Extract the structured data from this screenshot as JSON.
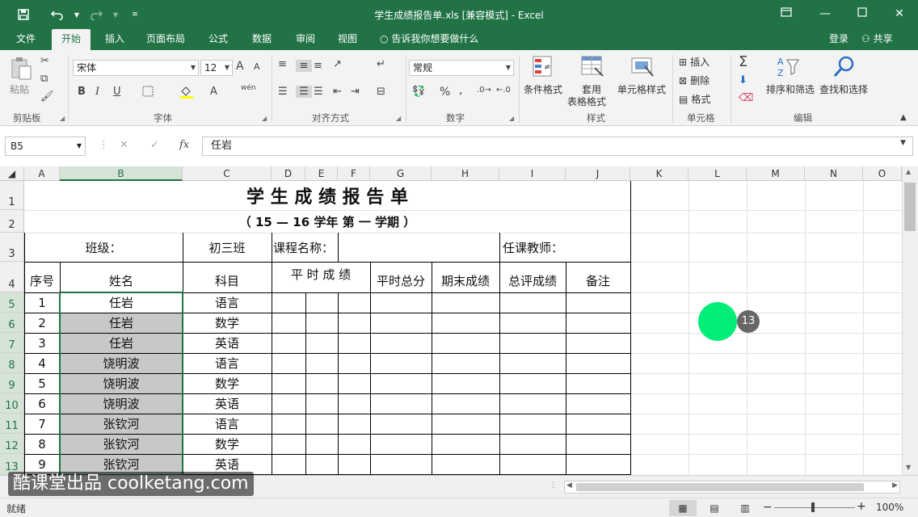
{
  "window": {
    "title": "学生成绩报告单.xls  [兼容模式] - Excel",
    "qat_icons": [
      "save-icon",
      "undo-icon",
      "redo-icon",
      "customize-icon"
    ]
  },
  "tabs": {
    "items": [
      "文件",
      "开始",
      "插入",
      "页面布局",
      "公式",
      "数据",
      "审阅",
      "视图"
    ],
    "active": "开始",
    "tellme": "告诉我你想要做什么",
    "login": "登录",
    "share": "共享"
  },
  "ribbon": {
    "clipboard": {
      "label": "剪贴板",
      "paste": "粘贴"
    },
    "font": {
      "label": "字体",
      "name": "宋体",
      "size": "12",
      "bold": "B",
      "italic": "I",
      "underline": "U",
      "grow": "A",
      "shrink": "A",
      "color_a": "A",
      "wen": "wén"
    },
    "alignment": {
      "label": "对齐方式"
    },
    "number": {
      "label": "数字",
      "format": "常规",
      "percent": "%",
      "comma": ","
    },
    "styles": {
      "label": "样式",
      "conditional": "条件格式",
      "table_line1": "套用",
      "table_line2": "表格格式",
      "cell_styles": "单元格样式"
    },
    "cells": {
      "label": "单元格",
      "insert": "插入",
      "delete": "删除",
      "format": "格式"
    },
    "editing": {
      "label": "编辑",
      "sort_filter": "排序和筛选",
      "find_select": "查找和选择"
    }
  },
  "formula_bar": {
    "name_box": "B5",
    "cancel": "✕",
    "enter": "✓",
    "fx": "fx",
    "value": "任岩"
  },
  "sheet": {
    "columns": [
      "A",
      "B",
      "C",
      "D",
      "E",
      "F",
      "G",
      "H",
      "I",
      "J",
      "K",
      "L",
      "M",
      "N",
      "O"
    ],
    "selected_column": "B",
    "rows": [
      "1",
      "2",
      "3",
      "4",
      "5",
      "6",
      "7",
      "8",
      "9",
      "10",
      "11",
      "12",
      "13"
    ],
    "selected_rows": [
      "5",
      "6",
      "7",
      "8",
      "9",
      "10",
      "11",
      "12",
      "13"
    ],
    "title": "学 生 成 绩 报 告 单",
    "subtitle": "（ 15 — 16    学年 第 一 学期 ）",
    "class_label": "班级：",
    "class_value": "初三班",
    "course_label": "课程名称：",
    "teacher_label": "任课教师：",
    "headers": [
      "序号",
      "姓名",
      "科目",
      "平 时 成 绩",
      "平时总分",
      "期末成绩",
      "总评成绩",
      "备注"
    ],
    "records": [
      {
        "no": "1",
        "name": "任岩",
        "subject": "语言"
      },
      {
        "no": "2",
        "name": "任岩",
        "subject": "数学"
      },
      {
        "no": "3",
        "name": "任岩",
        "subject": "英语"
      },
      {
        "no": "4",
        "name": "饶明波",
        "subject": "语言"
      },
      {
        "no": "5",
        "name": "饶明波",
        "subject": "数学"
      },
      {
        "no": "6",
        "name": "饶明波",
        "subject": "英语"
      },
      {
        "no": "7",
        "name": "张钦河",
        "subject": "语言"
      },
      {
        "no": "8",
        "name": "张钦河",
        "subject": "数学"
      },
      {
        "no": "9",
        "name": "张钦河",
        "subject": "英语"
      }
    ]
  },
  "status": {
    "ready": "就绪",
    "zoom": "100%",
    "minus": "−",
    "plus": "+"
  },
  "overlay": {
    "watermark": "酷课堂出品 coolketang.com",
    "step": "13"
  },
  "colors": {
    "brand": "#217346",
    "selection": "#c8c8c8",
    "cursor": "#00ee77"
  }
}
